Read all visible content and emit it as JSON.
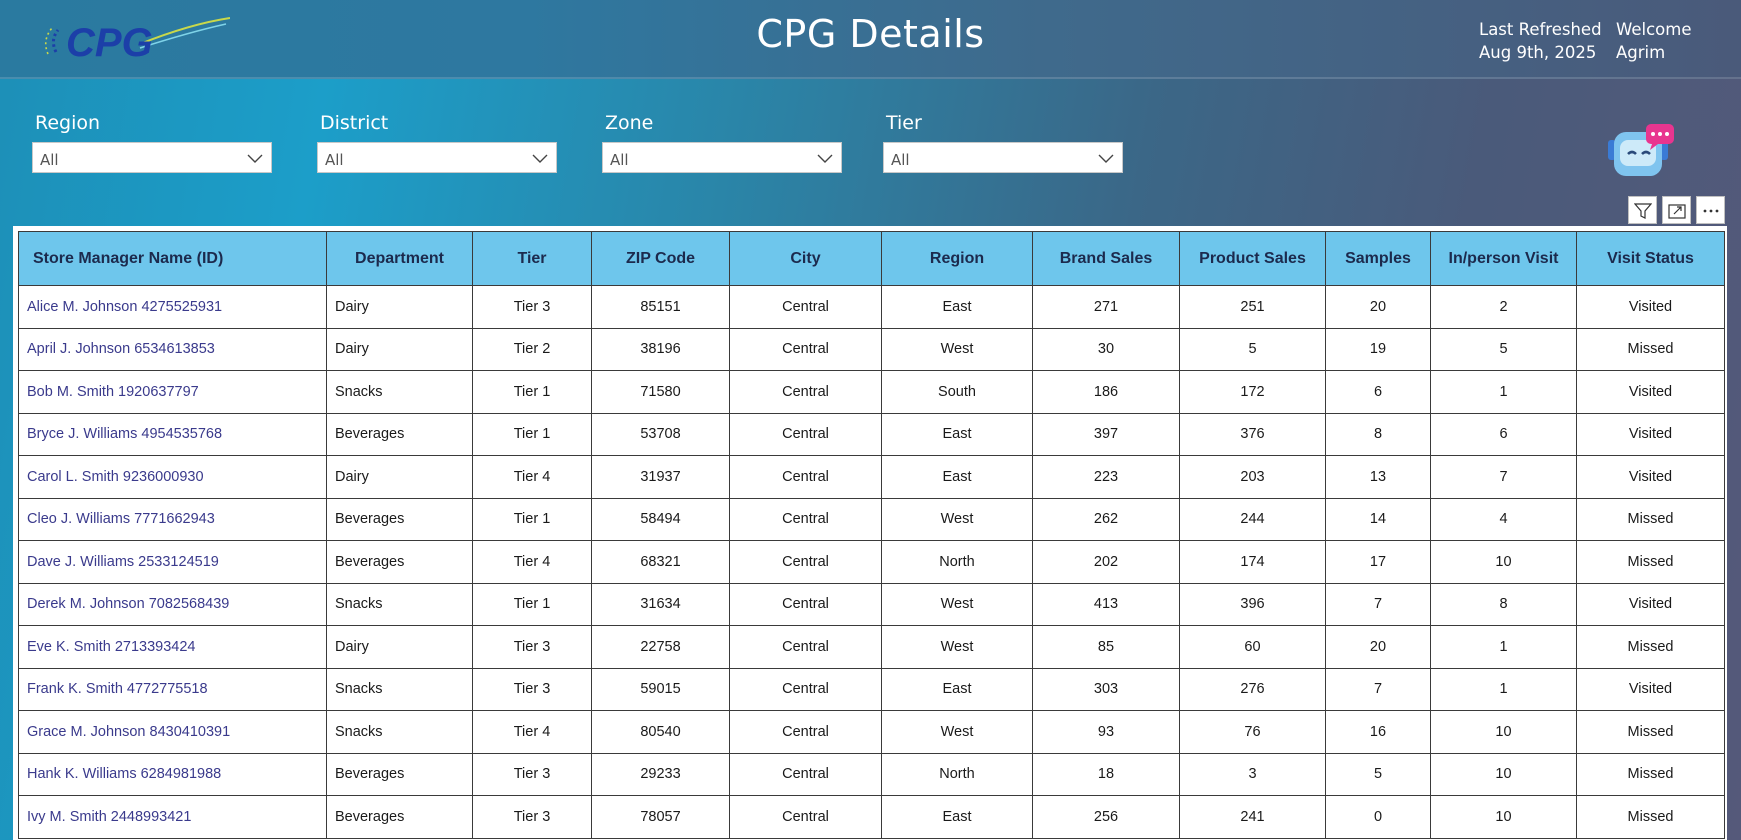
{
  "header": {
    "logo_text": "CPG",
    "title": "CPG Details",
    "refresh_label": "Last Refreshed",
    "refresh_date": "Aug 9th, 2025",
    "welcome_label": "Welcome",
    "user_name": "Agrim"
  },
  "filters": [
    {
      "label": "Region",
      "value": "All"
    },
    {
      "label": "District",
      "value": "All"
    },
    {
      "label": "Zone",
      "value": "All"
    },
    {
      "label": "Tier",
      "value": "All"
    }
  ],
  "colors": {
    "header_cell": "#6ec6ec",
    "name_text": "#3a3a8c",
    "accent_pink": "#e8358f"
  },
  "icons": {
    "filter": "filter-icon",
    "focus": "focus-mode-icon",
    "more": "more-options-icon",
    "chatbot": "chatbot-icon"
  },
  "table": {
    "columns": [
      "Store Manager Name (ID)",
      "Department",
      "Tier",
      "ZIP Code",
      "City",
      "Region",
      "Brand Sales",
      "Product Sales",
      "Samples",
      "In/person Visit",
      "Visit Status"
    ],
    "rows": [
      [
        "Alice M. Johnson 4275525931",
        "Dairy",
        "Tier 3",
        "85151",
        "Central",
        "East",
        "271",
        "251",
        "20",
        "2",
        "Visited"
      ],
      [
        "April J. Johnson 6534613853",
        "Dairy",
        "Tier 2",
        "38196",
        "Central",
        "West",
        "30",
        "5",
        "19",
        "5",
        "Missed"
      ],
      [
        "Bob M. Smith 1920637797",
        "Snacks",
        "Tier 1",
        "71580",
        "Central",
        "South",
        "186",
        "172",
        "6",
        "1",
        "Visited"
      ],
      [
        "Bryce J. Williams 4954535768",
        "Beverages",
        "Tier 1",
        "53708",
        "Central",
        "East",
        "397",
        "376",
        "8",
        "6",
        "Visited"
      ],
      [
        "Carol L. Smith 9236000930",
        "Dairy",
        "Tier 4",
        "31937",
        "Central",
        "East",
        "223",
        "203",
        "13",
        "7",
        "Visited"
      ],
      [
        "Cleo J. Williams 7771662943",
        "Beverages",
        "Tier 1",
        "58494",
        "Central",
        "West",
        "262",
        "244",
        "14",
        "4",
        "Missed"
      ],
      [
        "Dave J. Williams 2533124519",
        "Beverages",
        "Tier 4",
        "68321",
        "Central",
        "North",
        "202",
        "174",
        "17",
        "10",
        "Missed"
      ],
      [
        "Derek M. Johnson 7082568439",
        "Snacks",
        "Tier 1",
        "31634",
        "Central",
        "West",
        "413",
        "396",
        "7",
        "8",
        "Visited"
      ],
      [
        "Eve K. Smith 2713393424",
        "Dairy",
        "Tier 3",
        "22758",
        "Central",
        "West",
        "85",
        "60",
        "20",
        "1",
        "Missed"
      ],
      [
        "Frank K. Smith 4772775518",
        "Snacks",
        "Tier 3",
        "59015",
        "Central",
        "East",
        "303",
        "276",
        "7",
        "1",
        "Visited"
      ],
      [
        "Grace M. Johnson 8430410391",
        "Snacks",
        "Tier 4",
        "80540",
        "Central",
        "West",
        "93",
        "76",
        "16",
        "10",
        "Missed"
      ],
      [
        "Hank K. Williams 6284981988",
        "Beverages",
        "Tier 3",
        "29233",
        "Central",
        "North",
        "18",
        "3",
        "5",
        "10",
        "Missed"
      ],
      [
        "Ivy M. Smith 2448993421",
        "Beverages",
        "Tier 3",
        "78057",
        "Central",
        "East",
        "256",
        "241",
        "0",
        "10",
        "Missed"
      ]
    ]
  }
}
